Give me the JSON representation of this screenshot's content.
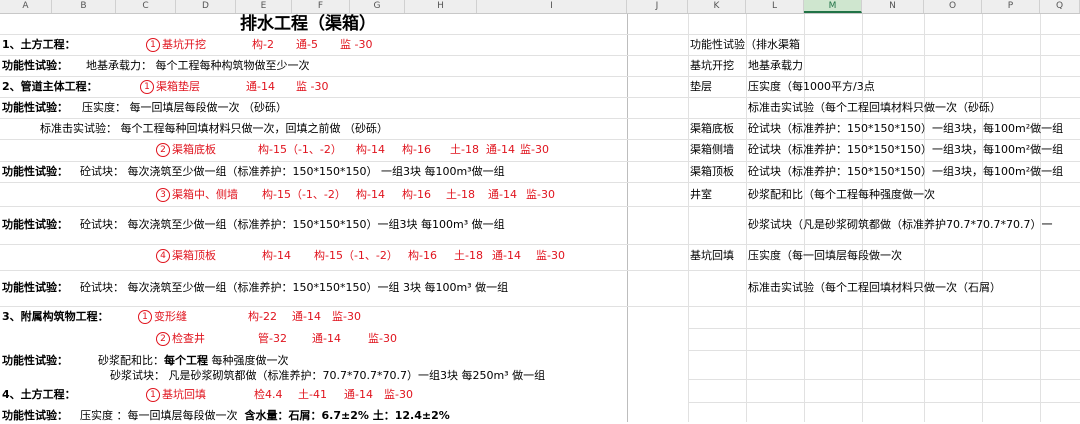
{
  "columns": [
    "A",
    "B",
    "C",
    "D",
    "E",
    "F",
    "G",
    "H",
    "I",
    "J",
    "K",
    "L",
    "M",
    "N",
    "O",
    "P",
    "Q"
  ],
  "title": "排水工程（渠箱）",
  "r1": {
    "label": "1、土方工程：",
    "num": "1",
    "item": "基坑开挖",
    "c1": "构-2",
    "c2": "通-5",
    "c3": "监 -30"
  },
  "r2": {
    "label": "功能性试验：",
    "text": "地基承载力：  每个工程每种构筑物做至少一次"
  },
  "r3": {
    "label": "2、管道主体工程：",
    "num": "1",
    "item": "渠箱垫层",
    "c1": "通-14",
    "c2": "监 -30"
  },
  "r4": {
    "label": "功能性试验：",
    "text": "压实度：  每一回填层每段做一次      （砂砾）"
  },
  "r5": {
    "text": "标准击实试验：  每个工程每种回填材料只做一次，回填之前做    （砂砾）"
  },
  "r6": {
    "num": "2",
    "item": "渠箱底板",
    "c1": "构-15（-1、-2）",
    "c2": "构-14",
    "c3": "构-16",
    "c4": "土-18",
    "c5": "通-14",
    "c6": "监-30"
  },
  "r7": {
    "label": "功能性试验：",
    "text": "砼试块：  每次浇筑至少做一组（标准养护：150*150*150） 一组3块  每100m³做一组"
  },
  "r8": {
    "num": "3",
    "item": "渠箱中、侧墙",
    "c1": "构-15（-1、-2）",
    "c2": "构-14",
    "c3": "构-16",
    "c4": "土-18",
    "c5": "通-14",
    "c6": "监-30"
  },
  "r9": {
    "label": "功能性试验：",
    "text": "砼试块：  每次浇筑至少做一组（标准养护：150*150*150）一组3块   每100m³ 做一组"
  },
  "r10": {
    "num": "4",
    "item": "渠箱顶板",
    "c1": "构-14",
    "c2": "构-15（-1、-2）",
    "c3": "构-16",
    "c4": "土-18",
    "c5": "通-14",
    "c6": "监-30"
  },
  "r11": {
    "label": "功能性试验：",
    "text": "砼试块：  每次浇筑至少做一组（标准养护：150*150*150）一组 3块  每100m³ 做一组"
  },
  "r12": {
    "label": "3、附属构筑物工程：",
    "num": "1",
    "item": "变形缝",
    "c1": "构-22",
    "c2": "通-14",
    "c3": "监-30"
  },
  "r13": {
    "num": "2",
    "item": "检查井",
    "c1": "管-32",
    "c2": "通-14",
    "c3": "监-30"
  },
  "r14": {
    "label": "功能性试验：",
    "text1": "砂浆配和比：",
    "bold": "每个工程",
    "text2": "每种强度做一次"
  },
  "r15": {
    "text": "砂浆试块：  凡是砂浆砌筑都做（标准养护：70.7*70.7*70.7）一组3块  每250m³ 做一组"
  },
  "r16": {
    "label": "4、土方工程：",
    "num": "1",
    "item": "基坑回填",
    "c1": "检4.4",
    "c2": "土-41",
    "c3": "通-14",
    "c4": "监-30"
  },
  "r17": {
    "label": "功能性试验：",
    "text": "压实度 ：每一回填层每段做一次",
    "bold": "含水量：石屑：6.7±2%    土：12.4±2%"
  },
  "side": [
    {
      "k": "",
      "v": "功能性试验（排水渠箱"
    },
    {
      "k": "基坑开挖",
      "v": "地基承载力"
    },
    {
      "k": "垫层",
      "v": "压实度（每1000平方/3点"
    },
    {
      "k": "",
      "v": "标准击实试验（每个工程回填材料只做一次（砂砾）"
    },
    {
      "k": "渠箱底板",
      "v": "砼试块（标准养护：150*150*150）一组3块，每100m²做一组"
    },
    {
      "k": "渠箱侧墙",
      "v": "砼试块（标准养护：150*150*150）一组3块，每100m²做一组"
    },
    {
      "k": "渠箱顶板",
      "v": "砼试块（标准养护：150*150*150）一组3块，每100m²做一组"
    },
    {
      "k": "井室",
      "v": "砂浆配和比（每个工程每种强度做一次"
    },
    {
      "k": "",
      "v": "砂浆试块（凡是砂浆砌筑都做（标准养护70.7*70.7*70.7）一"
    },
    {
      "k": "基坑回填",
      "v": "压实度（每一回填层每段做一次"
    },
    {
      "k": "",
      "v": "标准击实试验（每个工程回填材料只做一次（石屑）"
    }
  ],
  "colors": {
    "red": "#e0141e",
    "grid": "#e1e1e1",
    "header": "#eeeeee",
    "selected": "#217346"
  }
}
